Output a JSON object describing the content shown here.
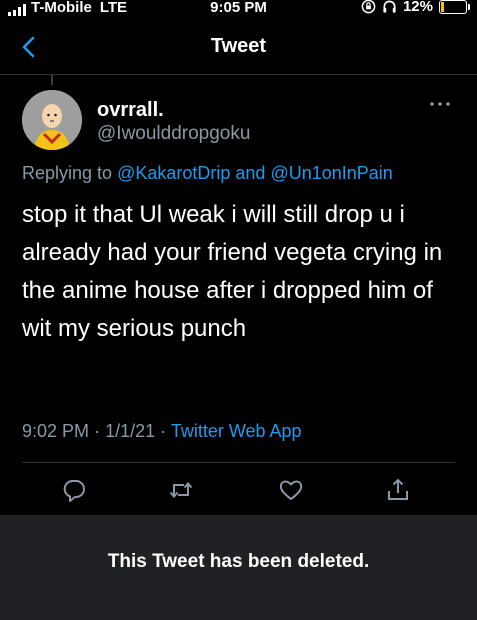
{
  "status_bar": {
    "carrier": "T-Mobile",
    "network": "LTE",
    "time": "9:05 PM",
    "battery_percent": "12%",
    "battery_level": 0.12,
    "battery_color": "#f5c400"
  },
  "header": {
    "back_icon": "chevron-left-icon",
    "title": "Tweet"
  },
  "tweet": {
    "display_name": "ovrrall.",
    "handle": "@Iwoulddropgoku",
    "replying_prefix": "Replying to",
    "replying_to": [
      "@KakarotDrip",
      "@Un1onInPain"
    ],
    "replying_joiner": "and",
    "text": "stop it that Ul weak i will still drop u i already had your friend vegeta crying in the anime house after i dropped him of wit my serious punch",
    "time": "9:02 PM",
    "date": "1/1/21",
    "source": "Twitter Web App"
  },
  "actions": [
    "reply-icon",
    "retweet-icon",
    "like-icon",
    "share-icon"
  ],
  "deleted_notice": "This Tweet has been deleted.",
  "colors": {
    "background": "#000000",
    "link": "#1d9bf0",
    "secondary_text": "#8b98a5",
    "deleted_banner": "#1f2124"
  }
}
